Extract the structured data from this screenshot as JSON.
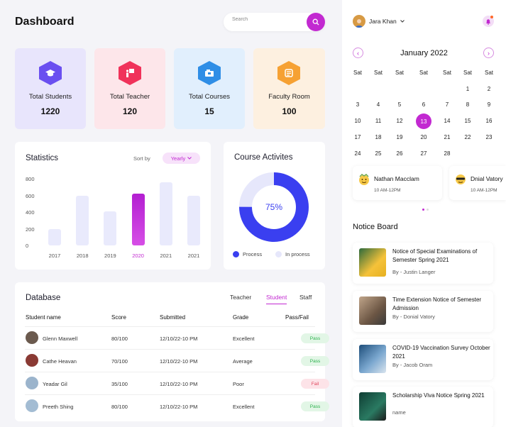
{
  "header": {
    "title": "Dashboard",
    "search_placeholder": "Search"
  },
  "cards": [
    {
      "label": "Total Students",
      "value": "1220",
      "bg": "#e8e5fc",
      "icon_bg": "#6a4ff0",
      "icon": "graduation-cap-icon"
    },
    {
      "label": "Total Teacher",
      "value": "120",
      "bg": "#fde6ea",
      "icon_bg": "#f0325a",
      "icon": "teacher-board-icon"
    },
    {
      "label": "Total Courses",
      "value": "15",
      "bg": "#e1effd",
      "icon_bg": "#2f8ee6",
      "icon": "courses-icon"
    },
    {
      "label": "Faculty Room",
      "value": "100",
      "bg": "#fdf0e0",
      "icon_bg": "#f6a133",
      "icon": "faculty-room-icon"
    }
  ],
  "statistics": {
    "title": "Statistics",
    "sort_label": "Sort by",
    "sort_value": "Yearly",
    "chart_data": {
      "type": "bar",
      "categories": [
        "2017",
        "2018",
        "2019",
        "2020",
        "2021",
        "2021"
      ],
      "values": [
        200,
        600,
        410,
        620,
        760,
        600
      ],
      "highlight_index": 3,
      "y_ticks": [
        "800",
        "600",
        "400",
        "200",
        "0"
      ],
      "ylim": [
        0,
        800
      ],
      "grid": false
    }
  },
  "course": {
    "title": "Course Activites",
    "percent_label": "75%",
    "chart_data": {
      "type": "pie",
      "categories": [
        "Process",
        "In process"
      ],
      "values": [
        75,
        25
      ]
    },
    "legend": [
      {
        "label": "Process",
        "color": "#3a3ff0"
      },
      {
        "label": "In process",
        "color": "#e6e7fb"
      }
    ]
  },
  "database": {
    "title": "Database",
    "tabs": [
      "Teacher",
      "Student",
      "Staff"
    ],
    "active_tab": 1,
    "columns": [
      "Student name",
      "Score",
      "Submitted",
      "Grade",
      "Pass/Fail"
    ],
    "rows": [
      {
        "name": "Glenn Maxwell",
        "score": "80/100",
        "submitted": "12/10/22-10 PM",
        "grade": "Excellent",
        "status": "Pass"
      },
      {
        "name": "Cathe Heavan",
        "score": "70/100",
        "submitted": "12/10/22-10 PM",
        "grade": "Average",
        "status": "Pass"
      },
      {
        "name": "Yeadar Gil",
        "score": "35/100",
        "submitted": "12/10/22-10 PM",
        "grade": "Poor",
        "status": "Fail"
      },
      {
        "name": "Preeth Shing",
        "score": "80/100",
        "submitted": "12/10/22-10 PM",
        "grade": "Excellent",
        "status": "Pass"
      }
    ]
  },
  "profile": {
    "name": "Jara Khan"
  },
  "calendar": {
    "month": "January 2022",
    "weekdays": [
      "Sat",
      "Sat",
      "Sat",
      "Sat",
      "Sat",
      "Sat",
      "Sat"
    ],
    "weeks": [
      [
        "",
        "",
        "",
        "",
        "",
        "1",
        "2"
      ],
      [
        "3",
        "4",
        "5",
        "6",
        "7",
        "8",
        "9"
      ],
      [
        "10",
        "11",
        "12",
        "13",
        "14",
        "15",
        "16"
      ],
      [
        "17",
        "18",
        "19",
        "20",
        "21",
        "22",
        "23"
      ],
      [
        "24",
        "25",
        "26",
        "27",
        "28",
        "",
        ""
      ]
    ],
    "selected": "13"
  },
  "events": [
    {
      "name": "Nathan Macclam",
      "time": "10 AM-12PM"
    },
    {
      "name": "Dnial Vatory",
      "time": "10 AM-12PM"
    }
  ],
  "notice_board": {
    "title": "Notice Board",
    "items": [
      {
        "title": "Notice of Special Examinations of Semester Spring 2021",
        "by": "By - Justin Langer"
      },
      {
        "title": "Time Extension Notice of Semester Admission",
        "by": "By - Donial Vatory"
      },
      {
        "title": "COVID-19 Vaccination Survey October 2021",
        "by": "By - Jacob Oram"
      },
      {
        "title": "Scholarship Viva Notice Spring 2021",
        "by": "name"
      }
    ]
  },
  "colors": {
    "accent": "#c229d1",
    "primary": "#3a3ff0",
    "bar": "#e9eafc"
  }
}
